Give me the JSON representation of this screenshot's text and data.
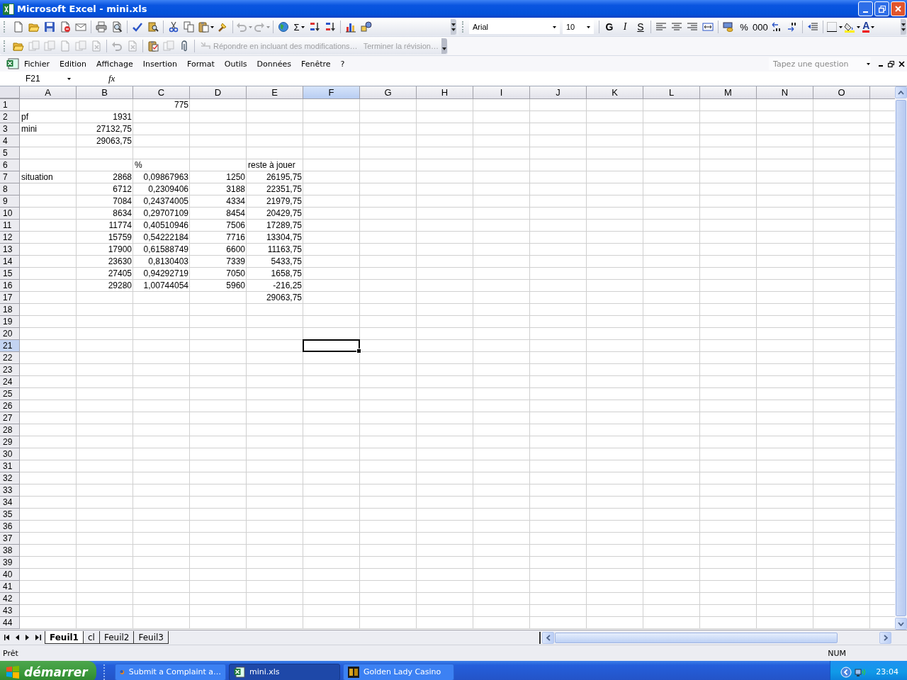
{
  "window": {
    "title": "Microsoft Excel - mini.xls"
  },
  "standard_toolbar": [
    {
      "kind": "new",
      "disabled": false
    },
    {
      "kind": "open",
      "disabled": false
    },
    {
      "kind": "save",
      "disabled": false
    },
    {
      "kind": "permission",
      "disabled": false
    },
    {
      "kind": "mail",
      "disabled": false
    },
    {
      "kind": "sep"
    },
    {
      "kind": "print",
      "disabled": false
    },
    {
      "kind": "preview",
      "disabled": false
    },
    {
      "kind": "sep"
    },
    {
      "kind": "spell",
      "disabled": false
    },
    {
      "kind": "research",
      "disabled": false
    },
    {
      "kind": "sep"
    },
    {
      "kind": "cut",
      "disabled": false
    },
    {
      "kind": "copy",
      "disabled": false
    },
    {
      "kind": "paste",
      "disabled": false,
      "menu": true
    },
    {
      "kind": "painter",
      "disabled": false
    },
    {
      "kind": "sep"
    },
    {
      "kind": "undo",
      "disabled": true,
      "menu": true
    },
    {
      "kind": "redo",
      "disabled": true,
      "menu": true
    },
    {
      "kind": "sep"
    },
    {
      "kind": "globe",
      "disabled": false
    },
    {
      "kind": "sum",
      "label": "Σ",
      "disabled": false,
      "menu": true
    },
    {
      "kind": "sort-asc",
      "disabled": false
    },
    {
      "kind": "sort-desc",
      "disabled": false
    },
    {
      "kind": "sep"
    },
    {
      "kind": "chart",
      "disabled": false
    },
    {
      "kind": "drawing",
      "disabled": false
    }
  ],
  "formatting_toolbar": {
    "font": "Arial",
    "size": "10",
    "buttons": [
      {
        "kind": "sep"
      },
      {
        "kind": "bold",
        "label": "G"
      },
      {
        "kind": "italic",
        "label": "I"
      },
      {
        "kind": "underline",
        "label": "S"
      },
      {
        "kind": "sep"
      },
      {
        "kind": "align-left"
      },
      {
        "kind": "align-center"
      },
      {
        "kind": "align-right"
      },
      {
        "kind": "merge"
      },
      {
        "kind": "sep"
      },
      {
        "kind": "currency"
      },
      {
        "kind": "text",
        "label": "%"
      },
      {
        "kind": "text",
        "label": "000"
      },
      {
        "kind": "inc-decimal"
      },
      {
        "kind": "dec-decimal"
      },
      {
        "kind": "sep"
      },
      {
        "kind": "indent"
      },
      {
        "kind": "sep"
      },
      {
        "kind": "borders",
        "menu": true
      },
      {
        "kind": "fill",
        "menu": true
      },
      {
        "kind": "font-color",
        "label": "A",
        "menu": true
      }
    ]
  },
  "reviewing_toolbar": {
    "buttons": [
      {
        "kind": "open",
        "disabled": false
      },
      {
        "kind": "pages",
        "disabled": true
      },
      {
        "kind": "pages",
        "disabled": true
      },
      {
        "kind": "page",
        "disabled": true
      },
      {
        "kind": "pages",
        "disabled": true
      },
      {
        "kind": "cancel",
        "disabled": true
      },
      {
        "kind": "sep"
      },
      {
        "kind": "undo",
        "disabled": true
      },
      {
        "kind": "cancel",
        "disabled": true
      },
      {
        "kind": "sep"
      },
      {
        "kind": "clipboard-check",
        "disabled": false
      },
      {
        "kind": "pages",
        "disabled": true
      },
      {
        "kind": "paperclip",
        "disabled": false
      },
      {
        "kind": "sep"
      }
    ],
    "reply": {
      "label": "Répondre en incluant des modifications…",
      "disabled": true
    },
    "end_review": {
      "label": "Terminer la révision…",
      "disabled": true
    }
  },
  "menu": [
    "Fichier",
    "Edition",
    "Affichage",
    "Insertion",
    "Format",
    "Outils",
    "Données",
    "Fenêtre",
    "?"
  ],
  "question_box": {
    "placeholder": "Tapez une question"
  },
  "formula_bar": {
    "name_box": "F21",
    "fx": "fx"
  },
  "sheet": {
    "columns": [
      {
        "label": "A",
        "selected": false
      },
      {
        "label": "B",
        "selected": false
      },
      {
        "label": "C",
        "selected": false
      },
      {
        "label": "D",
        "selected": false
      },
      {
        "label": "E",
        "selected": false
      },
      {
        "label": "F",
        "selected": true
      },
      {
        "label": "G",
        "selected": false
      },
      {
        "label": "H",
        "selected": false
      },
      {
        "label": "I",
        "selected": false
      },
      {
        "label": "J",
        "selected": false
      },
      {
        "label": "K",
        "selected": false
      },
      {
        "label": "L",
        "selected": false
      },
      {
        "label": "M",
        "selected": false
      },
      {
        "label": "N",
        "selected": false
      },
      {
        "label": "O",
        "selected": false
      }
    ],
    "rows": [
      {
        "label": "1",
        "selected": false,
        "cells": [
          null,
          null,
          {
            "text": "775",
            "kind": "number",
            "selected": false
          }
        ]
      },
      {
        "label": "2",
        "selected": false,
        "cells": [
          {
            "text": "pf",
            "kind": "text",
            "selected": false
          },
          {
            "text": "1931",
            "kind": "number",
            "selected": false
          }
        ]
      },
      {
        "label": "3",
        "selected": false,
        "cells": [
          {
            "text": "mini",
            "kind": "text",
            "selected": false
          },
          {
            "text": "27132,75",
            "kind": "number",
            "selected": false
          }
        ]
      },
      {
        "label": "4",
        "selected": false,
        "cells": [
          null,
          {
            "text": "29063,75",
            "kind": "number",
            "selected": false
          }
        ]
      },
      {
        "label": "5",
        "selected": false
      },
      {
        "label": "6",
        "selected": false,
        "cells": [
          null,
          null,
          {
            "text": "%",
            "kind": "text",
            "selected": false
          },
          null,
          {
            "text": "reste à jouer",
            "kind": "text",
            "selected": false
          }
        ]
      },
      {
        "label": "7",
        "selected": false,
        "cells": [
          {
            "text": "situation",
            "kind": "text",
            "selected": false
          },
          {
            "text": "2868",
            "kind": "number",
            "selected": false
          },
          {
            "text": "0,09867963",
            "kind": "number",
            "selected": false
          },
          {
            "text": "1250",
            "kind": "number",
            "selected": false
          },
          {
            "text": "26195,75",
            "kind": "number",
            "selected": false
          }
        ]
      },
      {
        "label": "8",
        "selected": false,
        "cells": [
          null,
          {
            "text": "6712",
            "kind": "number",
            "selected": false
          },
          {
            "text": "0,2309406",
            "kind": "number",
            "selected": false
          },
          {
            "text": "3188",
            "kind": "number",
            "selected": false
          },
          {
            "text": "22351,75",
            "kind": "number",
            "selected": false
          }
        ]
      },
      {
        "label": "9",
        "selected": false,
        "cells": [
          null,
          {
            "text": "7084",
            "kind": "number",
            "selected": false
          },
          {
            "text": "0,24374005",
            "kind": "number",
            "selected": false
          },
          {
            "text": "4334",
            "kind": "number",
            "selected": false
          },
          {
            "text": "21979,75",
            "kind": "number",
            "selected": false
          }
        ]
      },
      {
        "label": "10",
        "selected": false,
        "cells": [
          null,
          {
            "text": "8634",
            "kind": "number",
            "selected": false
          },
          {
            "text": "0,29707109",
            "kind": "number",
            "selected": false
          },
          {
            "text": "8454",
            "kind": "number",
            "selected": false
          },
          {
            "text": "20429,75",
            "kind": "number",
            "selected": false
          }
        ]
      },
      {
        "label": "11",
        "selected": false,
        "cells": [
          null,
          {
            "text": "11774",
            "kind": "number",
            "selected": false
          },
          {
            "text": "0,40510946",
            "kind": "number",
            "selected": false
          },
          {
            "text": "7506",
            "kind": "number",
            "selected": false
          },
          {
            "text": "17289,75",
            "kind": "number",
            "selected": false
          }
        ]
      },
      {
        "label": "12",
        "selected": false,
        "cells": [
          null,
          {
            "text": "15759",
            "kind": "number",
            "selected": false
          },
          {
            "text": "0,54222184",
            "kind": "number",
            "selected": false
          },
          {
            "text": "7716",
            "kind": "number",
            "selected": false
          },
          {
            "text": "13304,75",
            "kind": "number",
            "selected": false
          }
        ]
      },
      {
        "label": "13",
        "selected": false,
        "cells": [
          null,
          {
            "text": "17900",
            "kind": "number",
            "selected": false
          },
          {
            "text": "0,61588749",
            "kind": "number",
            "selected": false
          },
          {
            "text": "6600",
            "kind": "number",
            "selected": false
          },
          {
            "text": "11163,75",
            "kind": "number",
            "selected": false
          }
        ]
      },
      {
        "label": "14",
        "selected": false,
        "cells": [
          null,
          {
            "text": "23630",
            "kind": "number",
            "selected": false
          },
          {
            "text": "0,8130403",
            "kind": "number",
            "selected": false
          },
          {
            "text": "7339",
            "kind": "number",
            "selected": false
          },
          {
            "text": "5433,75",
            "kind": "number",
            "selected": false
          }
        ]
      },
      {
        "label": "15",
        "selected": false,
        "cells": [
          null,
          {
            "text": "27405",
            "kind": "number",
            "selected": false
          },
          {
            "text": "0,94292719",
            "kind": "number",
            "selected": false
          },
          {
            "text": "7050",
            "kind": "number",
            "selected": false
          },
          {
            "text": "1658,75",
            "kind": "number",
            "selected": false
          }
        ]
      },
      {
        "label": "16",
        "selected": false,
        "cells": [
          null,
          {
            "text": "29280",
            "kind": "number",
            "selected": false
          },
          {
            "text": "1,00744054",
            "kind": "number",
            "selected": false
          },
          {
            "text": "5960",
            "kind": "number",
            "selected": false
          },
          {
            "text": "-216,25",
            "kind": "number",
            "selected": false
          }
        ]
      },
      {
        "label": "17",
        "selected": false,
        "cells": [
          null,
          null,
          null,
          null,
          {
            "text": "29063,75",
            "kind": "number",
            "selected": false
          }
        ]
      },
      {
        "label": "18",
        "selected": false
      },
      {
        "label": "19",
        "selected": false
      },
      {
        "label": "20",
        "selected": false
      },
      {
        "label": "21",
        "selected": true,
        "cells": [
          null,
          null,
          null,
          null,
          null,
          {
            "selected": true
          }
        ]
      },
      {
        "label": "22",
        "selected": false
      },
      {
        "label": "23",
        "selected": false
      },
      {
        "label": "24",
        "selected": false
      },
      {
        "label": "25",
        "selected": false
      },
      {
        "label": "26",
        "selected": false
      },
      {
        "label": "27",
        "selected": false
      },
      {
        "label": "28",
        "selected": false
      },
      {
        "label": "29",
        "selected": false
      },
      {
        "label": "30",
        "selected": false
      },
      {
        "label": "31",
        "selected": false
      },
      {
        "label": "32",
        "selected": false
      },
      {
        "label": "33",
        "selected": false
      },
      {
        "label": "34",
        "selected": false
      },
      {
        "label": "35",
        "selected": false
      },
      {
        "label": "36",
        "selected": false
      },
      {
        "label": "37",
        "selected": false
      },
      {
        "label": "38",
        "selected": false
      },
      {
        "label": "39",
        "selected": false
      },
      {
        "label": "40",
        "selected": false
      },
      {
        "label": "41",
        "selected": false
      },
      {
        "label": "42",
        "selected": false
      },
      {
        "label": "43",
        "selected": false
      },
      {
        "label": "44",
        "selected": false
      }
    ]
  },
  "sheet_tabs": [
    {
      "label": "Feuil1",
      "selected": true
    },
    {
      "label": "cl",
      "selected": false
    },
    {
      "label": "Feuil2",
      "selected": false
    },
    {
      "label": "Feuil3",
      "selected": false
    }
  ],
  "status_bar": {
    "status": "Prêt",
    "num_lock": "NUM"
  },
  "taskbar": {
    "start": "démarrer",
    "tasks": [
      {
        "label": "Submit a Complaint a…",
        "kind": "browser",
        "selected": false
      },
      {
        "label": "mini.xls",
        "kind": "excel",
        "selected": true
      },
      {
        "label": "Golden Lady Casino",
        "kind": "casino",
        "selected": false
      }
    ],
    "clock": "23:04"
  }
}
